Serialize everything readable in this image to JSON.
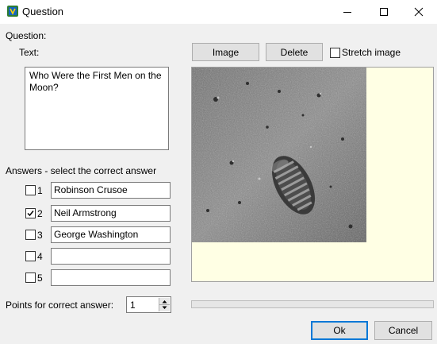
{
  "window": {
    "title": "Question",
    "icon": "app-icon",
    "controls": [
      "minimize-icon",
      "maximize-icon",
      "close-icon"
    ]
  },
  "question": {
    "section_label": "Question:",
    "text_label": "Text:",
    "text_value": "Who Were the First Men on the Moon?"
  },
  "image_toolbar": {
    "image_button": "Image",
    "delete_button": "Delete",
    "stretch_label": "Stretch image",
    "stretch_checked": false
  },
  "answers": {
    "section_label": "Answers - select the correct answer",
    "items": [
      {
        "number": "1",
        "text": "Robinson Crusoe",
        "checked": false
      },
      {
        "number": "2",
        "text": "Neil Armstrong",
        "checked": true
      },
      {
        "number": "3",
        "text": "George Washington",
        "checked": false
      },
      {
        "number": "4",
        "text": "",
        "checked": false
      },
      {
        "number": "5",
        "text": "",
        "checked": false
      }
    ]
  },
  "points": {
    "label": "Points for correct answer:",
    "value": "1"
  },
  "footer": {
    "ok_button": "Ok",
    "cancel_button": "Cancel"
  },
  "colors": {
    "image_panel_bg": "#ffffe4",
    "ok_border": "#0078d7"
  }
}
